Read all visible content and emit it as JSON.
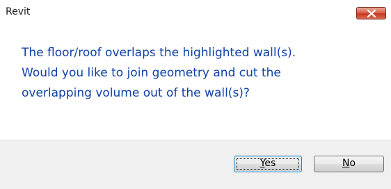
{
  "window": {
    "title": "Revit"
  },
  "message": {
    "lines": [
      "The floor/roof overlaps the highlighted wall(s).",
      "Would you like to join geometry and cut the",
      "overlapping volume out of the wall(s)?"
    ]
  },
  "buttons": {
    "yes": {
      "accel": "Y",
      "rest": "es"
    },
    "no": {
      "accel": "N",
      "rest": "o"
    }
  },
  "icons": {
    "close": "close-icon"
  },
  "colors": {
    "message_text": "#0f41a8",
    "close_button": "#c63a20",
    "footer_bg": "#f0f0f0"
  }
}
